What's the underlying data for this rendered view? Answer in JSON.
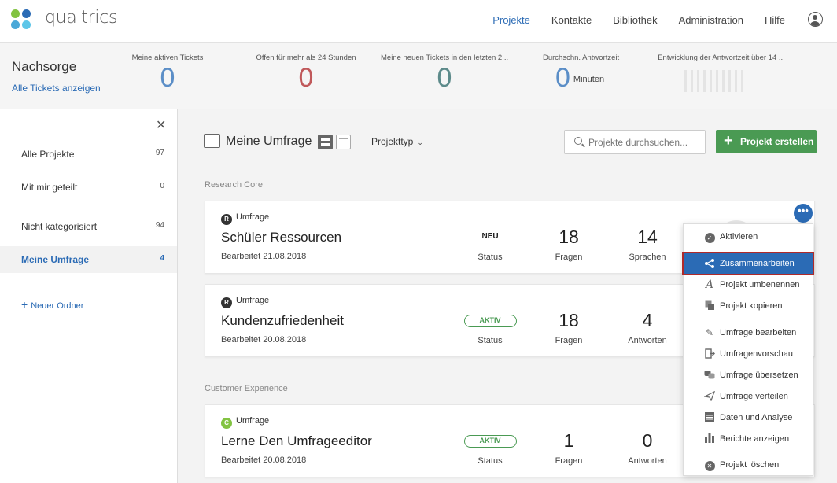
{
  "brand": "qualtrics",
  "nav": {
    "items": [
      "Projekte",
      "Kontakte",
      "Bibliothek",
      "Administration",
      "Hilfe"
    ]
  },
  "tickets": {
    "title": "Nachsorge",
    "link": "Alle Tickets anzeigen",
    "stats": [
      {
        "label": "Meine aktiven Tickets",
        "value": "0",
        "color": "#5b8ec7"
      },
      {
        "label": "Offen für mehr als 24 Stunden",
        "value": "0",
        "color": "#c0585a"
      },
      {
        "label": "Meine neuen Tickets in den letzten 2...",
        "value": "0",
        "color": "#5c8a8a"
      },
      {
        "label": "Durchschn. Antwortzeit",
        "value": "0",
        "unit": "Minuten",
        "color": "#5b8ec7"
      },
      {
        "label": "Entwicklung der Antwortzeit über 14 ..."
      }
    ]
  },
  "sidebar": {
    "items": [
      {
        "label": "Alle Projekte",
        "count": "97"
      },
      {
        "label": "Mit mir geteilt",
        "count": "0"
      },
      {
        "label": "Nicht kategorisiert",
        "count": "94"
      },
      {
        "label": "Meine Umfrage",
        "count": "4"
      }
    ],
    "new_folder": "Neuer Ordner"
  },
  "toolbar": {
    "title": "Meine Umfrage",
    "project_type": "Projekttyp",
    "search_placeholder": "Projekte durchsuchen...",
    "create_label": "Projekt erstellen"
  },
  "groups": [
    "Research Core",
    "Customer Experience"
  ],
  "projects": [
    {
      "type": "Umfrage",
      "name": "Schüler Ressourcen",
      "edited": "Bearbeitet 21.08.2018",
      "status": "NEU",
      "status_label": "Status",
      "questions": "18",
      "questions_label": "Fragen",
      "third": "14",
      "third_label": "Sprachen"
    },
    {
      "type": "Umfrage",
      "name": "Kundenzufriedenheit",
      "edited": "Bearbeitet 20.08.2018",
      "status": "AKTIV",
      "status_label": "Status",
      "questions": "18",
      "questions_label": "Fragen",
      "third": "4",
      "third_label": "Antworten"
    },
    {
      "type": "Umfrage",
      "name": "Lerne Den Umfrageeditor",
      "edited": "Bearbeitet 20.08.2018",
      "status": "AKTIV",
      "status_label": "Status",
      "questions": "1",
      "questions_label": "Fragen",
      "third": "0",
      "third_label": "Antworten"
    }
  ],
  "menu": {
    "items": [
      {
        "label": "Aktivieren",
        "icon": "check-circle-icon"
      },
      {
        "label": "Zusammenarbeiten",
        "icon": "share-icon"
      },
      {
        "label": "Projekt umbenennen",
        "icon": "rename-icon"
      },
      {
        "label": "Projekt kopieren",
        "icon": "copy-icon"
      },
      {
        "label": "Umfrage bearbeiten",
        "icon": "pencil-icon"
      },
      {
        "label": "Umfragenvorschau",
        "icon": "preview-icon"
      },
      {
        "label": "Umfrage übersetzen",
        "icon": "translate-icon"
      },
      {
        "label": "Umfrage verteilen",
        "icon": "send-icon"
      },
      {
        "label": "Daten und Analyse",
        "icon": "data-icon"
      },
      {
        "label": "Berichte anzeigen",
        "icon": "bar-chart-icon"
      },
      {
        "label": "Projekt löschen",
        "icon": "delete-circle-icon"
      }
    ]
  },
  "colors": {
    "accent": "#2b6bb5",
    "green": "#4a9a53",
    "highlight_border": "#b02a2a"
  }
}
